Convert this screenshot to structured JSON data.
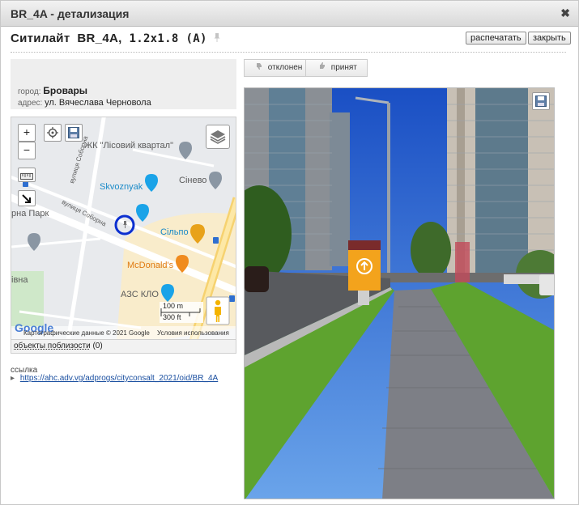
{
  "window": {
    "title": "BR_4A - детализация",
    "close_glyph": "✖"
  },
  "header": {
    "name": "Ситилайт",
    "code": "BR_4A,",
    "size": "1.2x1.8",
    "side": "(A)",
    "print_label": "распечатать",
    "close_label": "закрыть"
  },
  "info": {
    "city_label": "город:",
    "city": "Бровары",
    "address_label": "адрес:",
    "address": "ул. Вячеслава Черновола"
  },
  "map": {
    "zoom_in": "+",
    "zoom_out": "−",
    "labels": {
      "zhk": "ЖК \"Лісовий квартал\"",
      "sineva": "Сінево",
      "skoznyak": "Skvoznyak",
      "park": "рна Парк",
      "silpo": "Сільпо",
      "mcdonalds": "McDonald's",
      "azs": "АЗС КЛО",
      "vivna": "івна",
      "street1": "вулиця Соборна",
      "street2": "вулиця Соборна",
      "google": "Google"
    },
    "scale_m": "100 m",
    "scale_ft": "300 ft",
    "attribution": "Картографические данные © 2021 Google",
    "terms": "Условия использования"
  },
  "nearby": {
    "label": "объекты поблизости",
    "count": "(0)"
  },
  "link": {
    "label": "ссылка",
    "bullet": "▸",
    "url": "https://ahc.adv.vg/adprogs/cityconsalt_2021/oid/BR_4A"
  },
  "vote": {
    "rejected": "отклонен",
    "accepted": "принят"
  },
  "colors": {
    "accent_circle": "#0b2fd0",
    "sky": "#1f5fd6",
    "grass": "#5ea32f",
    "pavement": "#7d7f86"
  }
}
